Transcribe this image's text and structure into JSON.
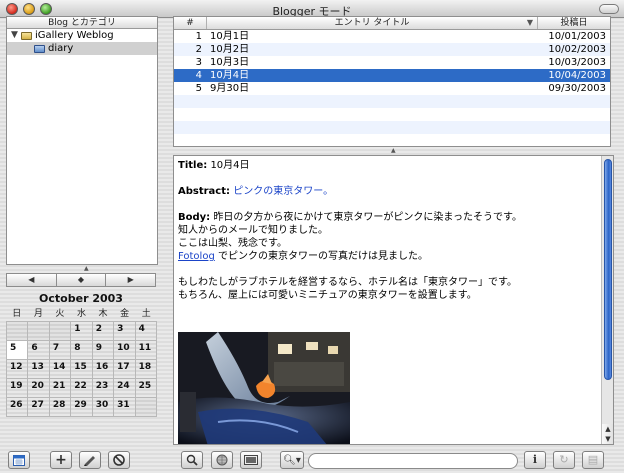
{
  "window": {
    "title": "Blogger モード"
  },
  "sidebar": {
    "header": "Blog とカテゴリ",
    "items": [
      {
        "label": "iGallery Weblog",
        "expanded": true
      },
      {
        "label": "diary",
        "selected": true
      }
    ]
  },
  "calendar": {
    "title": "October 2003",
    "weekdays": [
      "日",
      "月",
      "火",
      "水",
      "木",
      "金",
      "土"
    ],
    "leading_blanks": 3,
    "days": 31,
    "today": 5
  },
  "entries": {
    "columns": {
      "num": "#",
      "title": "エントリ タイトル",
      "date": "投稿日"
    },
    "rows": [
      {
        "num": "1",
        "title": "10月1日",
        "date": "10/01/2003"
      },
      {
        "num": "2",
        "title": "10月2日",
        "date": "10/02/2003"
      },
      {
        "num": "3",
        "title": "10月3日",
        "date": "10/03/2003"
      },
      {
        "num": "4",
        "title": "10月4日",
        "date": "10/04/2003",
        "selected": true
      },
      {
        "num": "5",
        "title": "9月30日",
        "date": "09/30/2003"
      }
    ]
  },
  "detail": {
    "title_label": "Title:",
    "title_value": "10月4日",
    "abstract_label": "Abstract:",
    "abstract_value": "ピンクの東京タワー。",
    "body_label": "Body:",
    "body_line1": "昨日の夕方から夜にかけて東京タワーがピンクに染まったそうです。",
    "body_line2": "知人からのメールで知りました。",
    "body_line3": "ここは山梨、残念です。",
    "fotolog_link": "Fotolog",
    "body_line4_rest": " でピンクの東京タワーの写真だけは見ました。",
    "body_line5": "もしわたしがラブホテルを経営するなら、ホテル名は「東京タワー」です。",
    "body_line6": "もちろん、屋上には可愛いミニチュアの東京タワーを設置します。"
  },
  "colors": {
    "selection": "#2d6bc6",
    "link": "#1b44c8",
    "scroll_thumb": "#2a63c7"
  },
  "icons": {
    "calendar_toggle": "calendar-icon",
    "add": "plus-icon",
    "edit": "pencil-icon",
    "delete": "no-entry-icon",
    "zoom": "magnifier-icon",
    "web": "globe-icon",
    "display": "screen-icon",
    "search": "search-icon",
    "info": "info-icon",
    "refresh": "refresh-icon",
    "book": "book-icon"
  }
}
